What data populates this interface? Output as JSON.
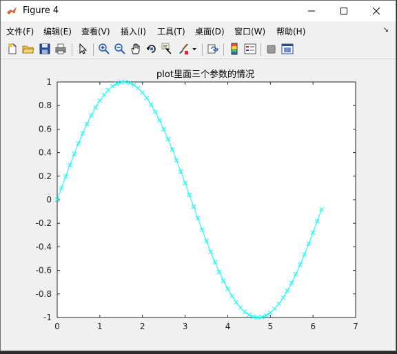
{
  "window": {
    "title": "Figure 4",
    "controls": [
      "minimize",
      "maximize",
      "close"
    ]
  },
  "menu": {
    "items": [
      "文件(F)",
      "编辑(E)",
      "查看(V)",
      "插入(I)",
      "工具(T)",
      "桌面(D)",
      "窗口(W)",
      "帮助(H)"
    ],
    "overflow_arrow": "↘"
  },
  "toolbar": {
    "tools": [
      "new-figure-icon",
      "open-file-icon",
      "save-icon",
      "print-icon",
      "edit-plot-arrow-icon",
      "zoom-in-icon",
      "zoom-out-icon",
      "pan-hand-icon",
      "rotate-3d-icon",
      "data-cursor-icon",
      "brush-icon",
      "brush-dropdown-icon",
      "link-plot-icon",
      "insert-colorbar-icon",
      "insert-legend-icon",
      "hide-plot-tools-icon",
      "show-plot-tools-icon"
    ]
  },
  "chart_data": {
    "type": "line",
    "title": "plot里面三个参数的情况",
    "marker": "x",
    "line_color": "#00ffff",
    "xlim": [
      0,
      7
    ],
    "ylim": [
      -1,
      1
    ],
    "x_ticks": [
      "0",
      "1",
      "2",
      "3",
      "4",
      "5",
      "6",
      "7"
    ],
    "y_ticks": [
      "1",
      "0.8",
      "0.6",
      "0.4",
      "0.2",
      "0",
      "-0.2",
      "-0.4",
      "-0.6",
      "-0.8",
      "-1"
    ],
    "x": [
      0,
      0.1,
      0.2,
      0.3,
      0.4,
      0.5,
      0.6,
      0.7,
      0.8,
      0.9,
      1.0,
      1.1,
      1.2,
      1.3,
      1.4,
      1.5,
      1.6,
      1.7,
      1.8,
      1.9,
      2.0,
      2.1,
      2.2,
      2.3,
      2.4,
      2.5,
      2.6,
      2.7,
      2.8,
      2.9,
      3.0,
      3.1,
      3.2,
      3.3,
      3.4,
      3.5,
      3.6,
      3.7,
      3.8,
      3.9,
      4.0,
      4.1,
      4.2,
      4.3,
      4.4,
      4.5,
      4.6,
      4.7,
      4.8,
      4.9,
      5.0,
      5.1,
      5.2,
      5.3,
      5.4,
      5.5,
      5.6,
      5.7,
      5.8,
      5.9,
      6.0,
      6.1,
      6.2
    ],
    "y": [
      0,
      0.0998,
      0.1987,
      0.2955,
      0.3894,
      0.4794,
      0.5646,
      0.6442,
      0.7174,
      0.7833,
      0.8415,
      0.8912,
      0.932,
      0.9636,
      0.9854,
      0.9975,
      0.9996,
      0.9917,
      0.9738,
      0.9463,
      0.9093,
      0.8632,
      0.8085,
      0.7457,
      0.6755,
      0.5985,
      0.5155,
      0.4274,
      0.335,
      0.2392,
      0.1411,
      0.0416,
      -0.0584,
      -0.1577,
      -0.2555,
      -0.3508,
      -0.4425,
      -0.5298,
      -0.6119,
      -0.6878,
      -0.7568,
      -0.8183,
      -0.8716,
      -0.9162,
      -0.9516,
      -0.9775,
      -0.9937,
      -0.9999,
      -0.9962,
      -0.9825,
      -0.9589,
      -0.9258,
      -0.8835,
      -0.8323,
      -0.7728,
      -0.7055,
      -0.6313,
      -0.5507,
      -0.4646,
      -0.3739,
      -0.2794,
      -0.1822,
      -0.0831
    ]
  }
}
